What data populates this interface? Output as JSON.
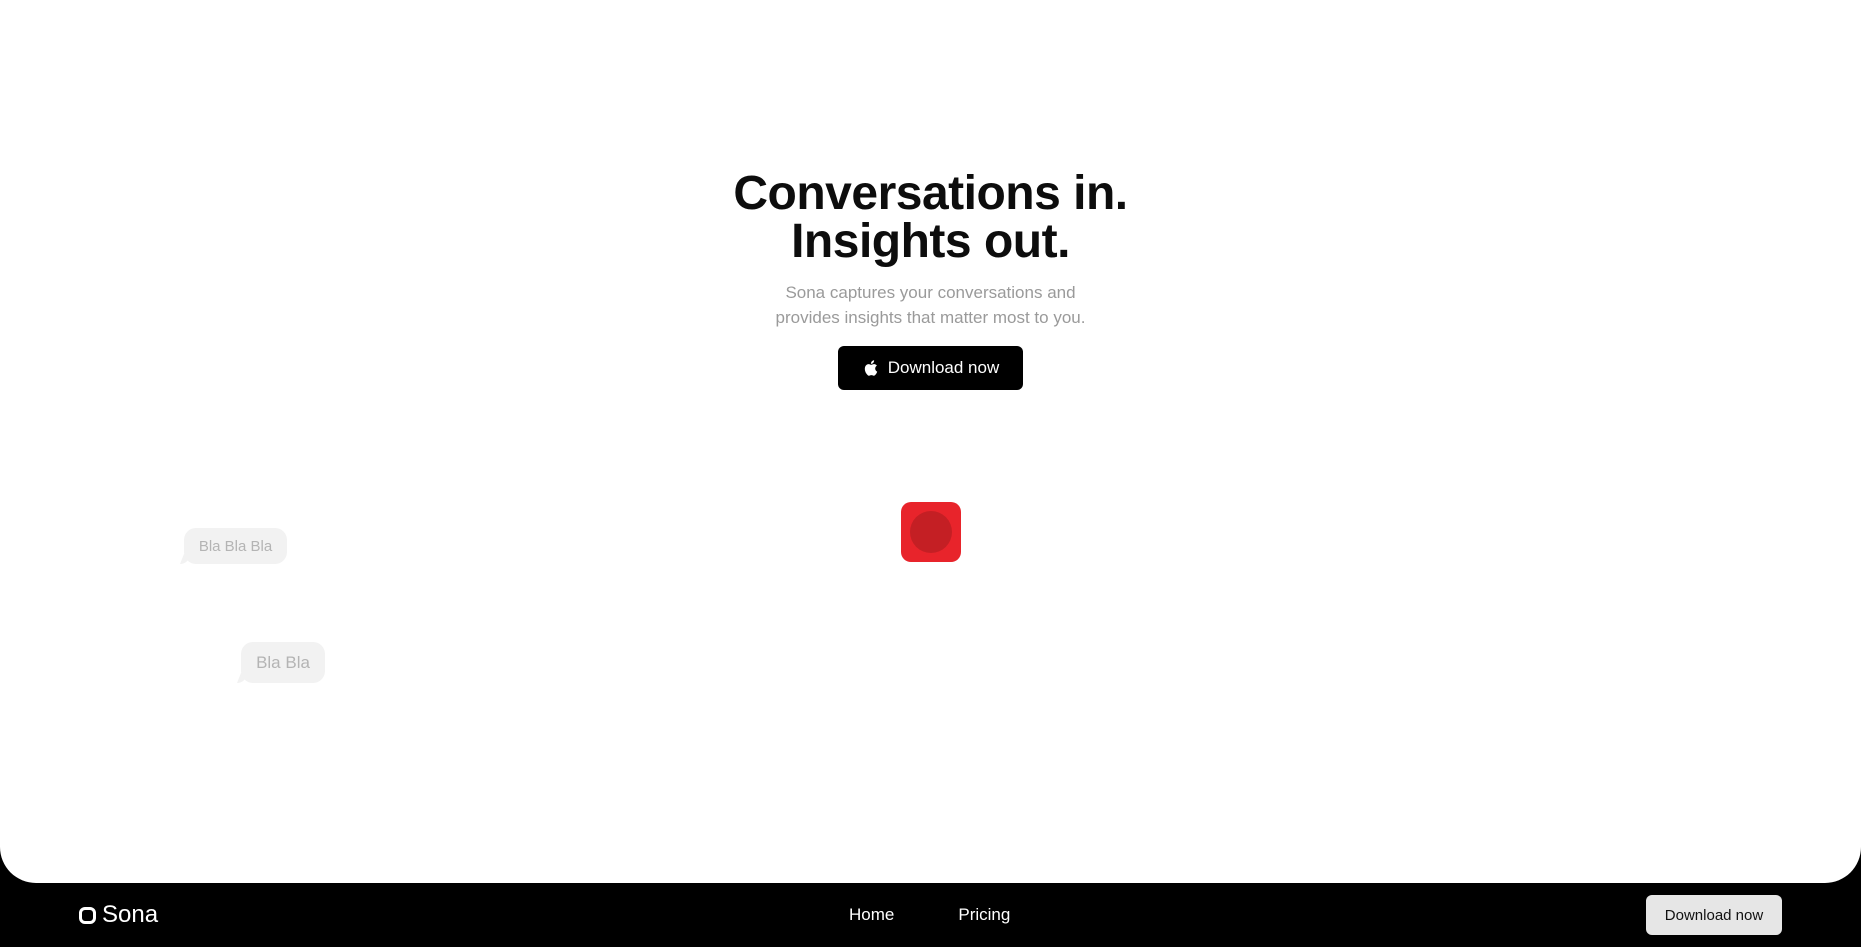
{
  "hero": {
    "headline_line1": "Conversations in.",
    "headline_line2": "Insights out.",
    "subtitle_line1": "Sona captures your conversations and",
    "subtitle_line2": "provides insights that matter most to you.",
    "cta_label": "Download now",
    "cta_icon": "apple-icon"
  },
  "bubbles": [
    {
      "text": "Bla Bla Bla"
    },
    {
      "text": "Bla Bla"
    }
  ],
  "record_button": {
    "icon": "record-icon",
    "color": "#e8242b"
  },
  "navbar": {
    "logo_text": "Sona",
    "logo_icon": "rounded-square-icon",
    "links": [
      {
        "label": "Home"
      },
      {
        "label": "Pricing"
      }
    ],
    "cta_label": "Download now"
  },
  "colors": {
    "background": "#ffffff",
    "footer": "#000000",
    "accent": "#e8242b",
    "muted_text": "#9a9a9a"
  }
}
